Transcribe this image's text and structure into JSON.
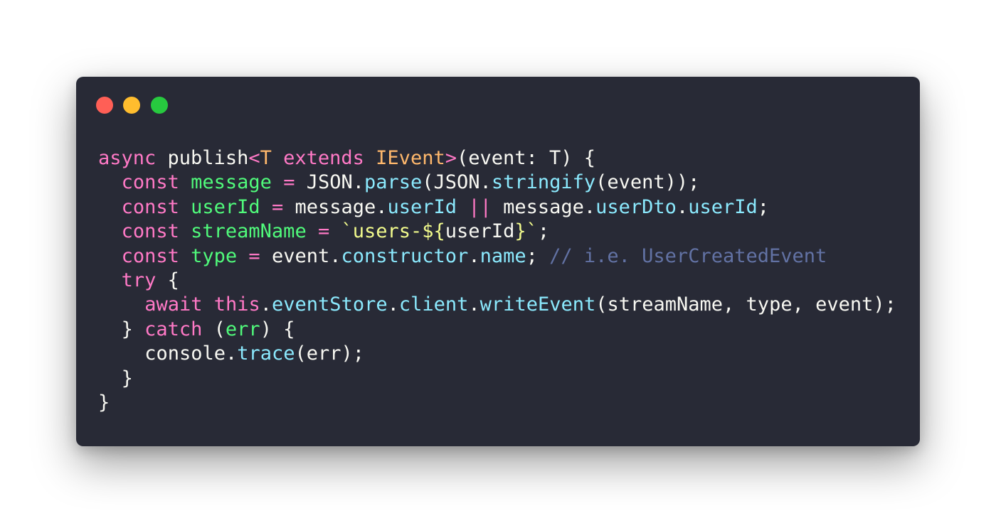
{
  "colors": {
    "background": "#282a36",
    "close": "#ff5f56",
    "minimize": "#ffbd2e",
    "zoom": "#27c93f",
    "keyword": "#ff79c6",
    "type": "#ffb86c",
    "variable": "#50fa7b",
    "property": "#8be9fd",
    "string": "#f1fa8c",
    "comment": "#6272a4",
    "text": "#f8f8f2"
  },
  "window_controls": [
    "close",
    "minimize",
    "zoom"
  ],
  "language": "TypeScript",
  "code": {
    "l1": {
      "a": "async",
      "b": " publish",
      "c": "<",
      "d": "T",
      "e": " extends ",
      "f": "IEvent",
      "g": ">",
      "h": "(event: T) {"
    },
    "l2": {
      "a": "const",
      "b": " ",
      "c": "message",
      "d": " = ",
      "e": "JSON.",
      "f": "parse",
      "g": "(JSON.",
      "h": "stringify",
      "i": "(event));"
    },
    "l3": {
      "a": "const",
      "b": " ",
      "c": "userId",
      "d": " = ",
      "e": "message.",
      "f": "userId",
      "g": " || ",
      "h": "message.",
      "i": "userDto",
      "j": ".",
      "k": "userId",
      "l": ";"
    },
    "l4": {
      "a": "const",
      "b": " ",
      "c": "streamName",
      "d": " = ",
      "e": "`users-",
      "f": "${",
      "g": "userId",
      "h": "}",
      "i": "`",
      "j": ";"
    },
    "l5": {
      "a": "const",
      "b": " ",
      "c": "type",
      "d": " = ",
      "e": "event.",
      "f": "constructor",
      "g": ".",
      "h": "name",
      "i": "; ",
      "j": "// i.e. UserCreatedEvent"
    },
    "l6": {
      "a": "try",
      "b": " {"
    },
    "l7": {
      "a": "await",
      "b": " ",
      "c": "this",
      "d": ".",
      "e": "eventStore",
      "f": ".",
      "g": "client",
      "h": ".",
      "i": "writeEvent",
      "j": "(streamName, type, event);"
    },
    "l8": {
      "a": "} ",
      "b": "catch",
      "c": " (",
      "d": "err",
      "e": ") {"
    },
    "l9": {
      "a": "console.",
      "b": "trace",
      "c": "(err);"
    },
    "l10": {
      "a": "}"
    },
    "l11": {
      "a": "}"
    }
  }
}
